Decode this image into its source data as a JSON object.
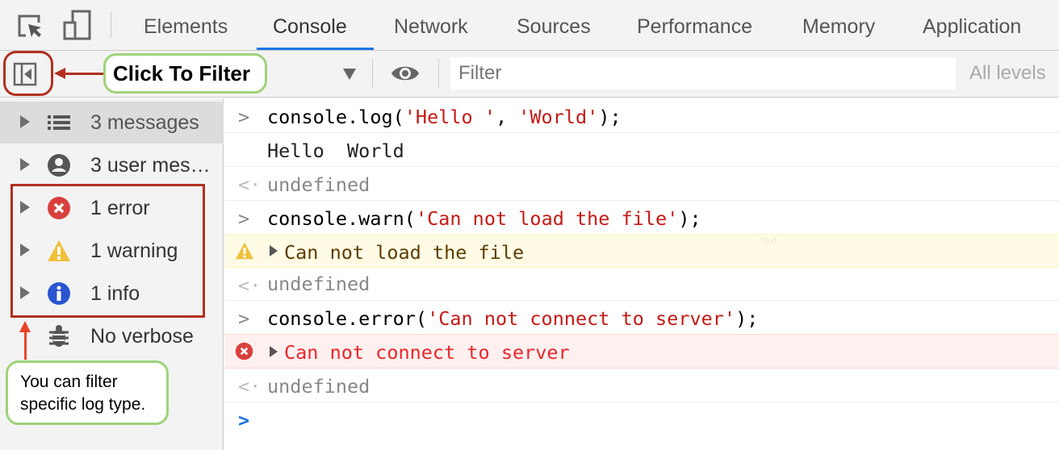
{
  "tabs": [
    {
      "label": "Elements"
    },
    {
      "label": "Console",
      "active": true
    },
    {
      "label": "Network"
    },
    {
      "label": "Sources"
    },
    {
      "label": "Performance"
    },
    {
      "label": "Memory"
    },
    {
      "label": "Application"
    }
  ],
  "toolbar": {
    "context": "",
    "filter_placeholder": "Filter",
    "levels": "All levels"
  },
  "sidebar": {
    "items": [
      {
        "label": "3 messages",
        "icon": "list-icon",
        "selected": true
      },
      {
        "label": "3 user mes…",
        "icon": "user-icon"
      },
      {
        "label": "1 error",
        "icon": "error-icon"
      },
      {
        "label": "1 warning",
        "icon": "warning-icon"
      },
      {
        "label": "1 info",
        "icon": "info-icon"
      },
      {
        "label": "No verbose",
        "icon": "bug-icon"
      }
    ]
  },
  "console": {
    "log_cmd": {
      "a": "console.log(",
      "s1": "'Hello '",
      "b": ", ",
      "s2": "'World'",
      "c": ");"
    },
    "log_out": "Hello  World",
    "undefined": "undefined",
    "warn_cmd": {
      "a": "console.warn(",
      "s": "'Can not load the file'",
      "c": ");"
    },
    "warn_out": "Can not load the file",
    "err_cmd": {
      "a": "console.error(",
      "s": "'Can not connect to server'",
      "c": ");"
    },
    "err_out": "Can not connect to server",
    "watermark": "Text"
  },
  "annotations": {
    "click_to_filter": "Click To Filter",
    "filter_tip": "You can filter specific log type."
  },
  "colors": {
    "accent": "#1a73e8",
    "annotation_red": "#b0301f",
    "annotation_green": "#9fd27a",
    "error": "#d93025",
    "warning": "#f0c03a",
    "info": "#2a55d0"
  }
}
